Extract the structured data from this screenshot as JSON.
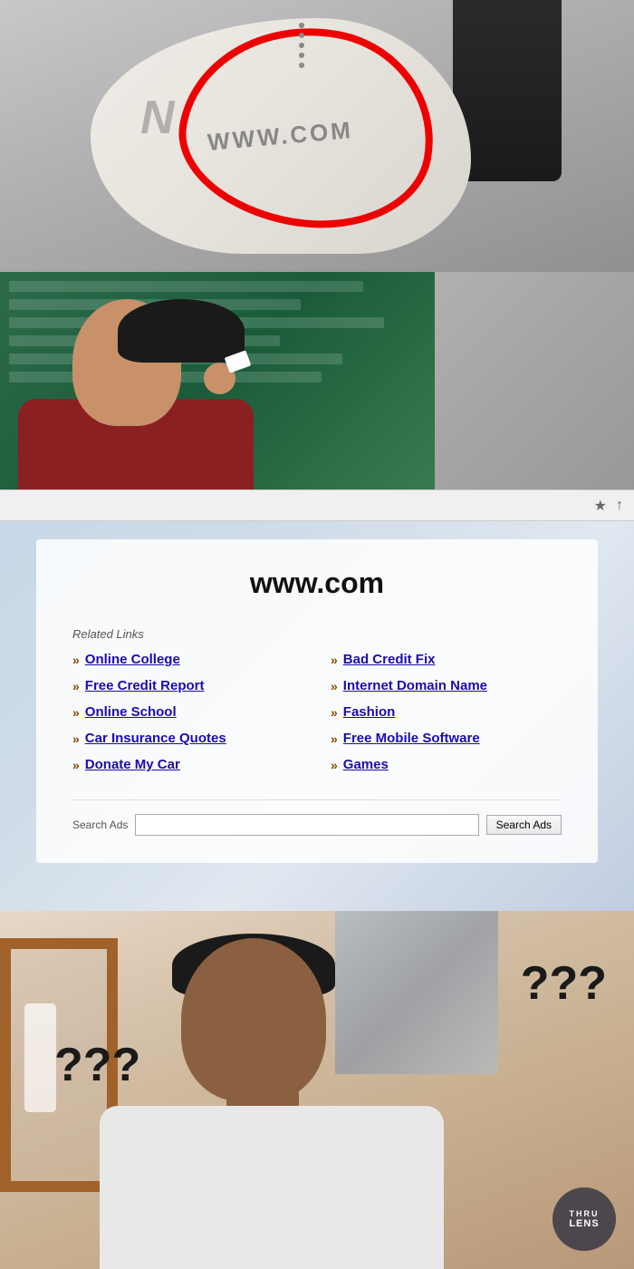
{
  "sneaker": {
    "url_text": "WWW.COM",
    "section_label": "sneaker-photo"
  },
  "browser": {
    "bookmark_icon": "★",
    "share_icon": "↑"
  },
  "wwwcom": {
    "title": "www.com",
    "related_links_label": "Related Links",
    "links": [
      {
        "label": "Online College",
        "col": 0
      },
      {
        "label": "Bad Credit Fix",
        "col": 1
      },
      {
        "label": "Free Credit Report",
        "col": 0
      },
      {
        "label": "Internet Domain Name",
        "col": 1
      },
      {
        "label": "Online School",
        "col": 0
      },
      {
        "label": "Fashion",
        "col": 1
      },
      {
        "label": "Car Insurance Quotes",
        "col": 0
      },
      {
        "label": "Free Mobile Software",
        "col": 1
      },
      {
        "label": "Donate My Car",
        "col": 0
      },
      {
        "label": "Games",
        "col": 1
      }
    ],
    "search_ads_label": "Search Ads",
    "search_ads_placeholder": "",
    "search_ads_button": "Search Ads"
  },
  "confused": {
    "question_marks_right": "???",
    "question_marks_left": "???",
    "watermark_line1": "THRU",
    "watermark_line2": "LENS"
  }
}
